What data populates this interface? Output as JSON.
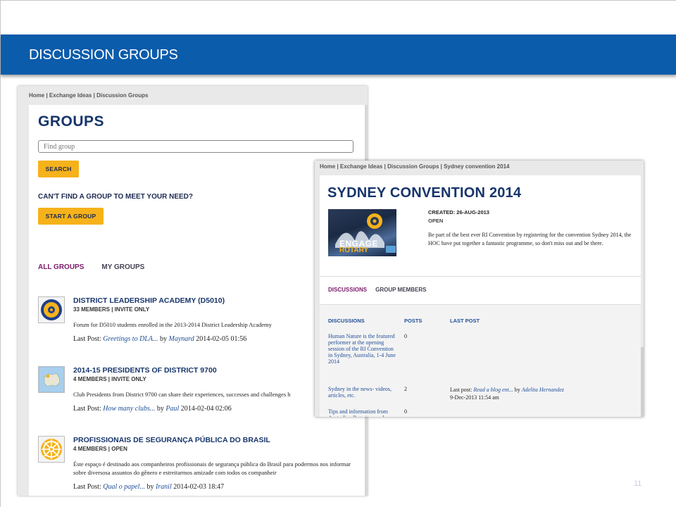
{
  "slide": {
    "title": "DISCUSSION GROUPS",
    "page_number": "11"
  },
  "groups_page": {
    "breadcrumb": "Home | Exchange Ideas | Discussion Groups",
    "heading": "GROUPS",
    "search_placeholder": "Find group",
    "search_button": "SEARCH",
    "cant_find": "CAN'T FIND A GROUP TO MEET YOUR NEED?",
    "start_button": "START A GROUP",
    "tabs": [
      {
        "label": "ALL GROUPS",
        "active": true
      },
      {
        "label": "MY GROUPS",
        "active": false
      }
    ],
    "items": [
      {
        "title": "DISTRICT LEADERSHIP ACADEMY (D5010)",
        "meta": "33 MEMBERS | INVITE ONLY",
        "description": "Forum for D5010 students enrolled in the 2013-2014 District Leadership Academy",
        "last_post_label": "Last Post:",
        "last_post_title": "Greetings to DLA...",
        "by": "by",
        "author": "Maynard",
        "date": "2014-02-05 01:56",
        "icon": "rotary-wheel-icon"
      },
      {
        "title": "2014-15 PRESIDENTS OF DISTRICT 9700",
        "meta": "4 MEMBERS | INVITE ONLY",
        "description": "Club Presidents from District 9700 can share their experiences, successes and challenges h",
        "last_post_label": "Last Post:",
        "last_post_title": "How many clubs...",
        "by": "by",
        "author": "Paul",
        "date": "2014-02-04 02:06",
        "icon": "australia-map-icon"
      },
      {
        "title": "PROFISSIONAIS DE SEGURANÇA PÚBLICA DO BRASIL",
        "meta": "4 MEMBERS | OPEN",
        "description": "Éste espaço é destinado aos companheiros profissionais de segurança pública do Brasil para podermos nos informar sobre diversosa assuntos do gênero e estreitarmos amizade com todos os companheir",
        "last_post_label": "Last Post:",
        "last_post_title": "Qual o papel...",
        "by": "by",
        "author": "Iranil",
        "date": "2014-02-03 18:47",
        "icon": "rotary-wheel-icon"
      }
    ]
  },
  "group_detail": {
    "breadcrumb": "Home | Exchange Ideas | Discussion Groups | Sydney convention 2014",
    "heading": "SYDNEY CONVENTION 2014",
    "image_text_1": "ENGAGE",
    "image_text_2": "ROTARY",
    "created": "CREATED: 26-AUG-2013",
    "status": "OPEN",
    "description": "Be part of the best ever RI Convention by registering for the convention Sydney 2014, the HOC have put together a fantastic programme, so don't miss out and be there.",
    "tabs": [
      {
        "label": "DISCUSSIONS",
        "active": true
      },
      {
        "label": "GROUP MEMBERS",
        "active": false
      }
    ],
    "columns": [
      "DISCUSSIONS",
      "POSTS",
      "LAST POST"
    ],
    "rows": [
      {
        "topic": "Human Nature is the featured performer at the opening session of the RI Convention in Sydney, Australia, 1-4 June 2014",
        "posts": "0",
        "last_post_prefix": "",
        "last_post_title": "",
        "by": "",
        "author": "",
        "date": ""
      },
      {
        "topic": "Sydney in the news- videos, articles, etc.",
        "posts": "2",
        "last_post_prefix": "Last post:",
        "last_post_title": "Read a blog ent...",
        "by": "by",
        "author": "Adelita Hernandez",
        "date": "9-Dec-2013 11:54 am"
      },
      {
        "topic": "Tips and information from Australian Rotarians and Rotaractors",
        "posts": "0",
        "last_post_prefix": "",
        "last_post_title": "",
        "by": "",
        "author": "",
        "date": ""
      }
    ]
  },
  "colors": {
    "banner": "#0b5cab",
    "heading_navy": "#17356b",
    "button_gold": "#f6b21b",
    "active_tab": "#7a1b6b",
    "link_blue": "#1f4e96"
  }
}
